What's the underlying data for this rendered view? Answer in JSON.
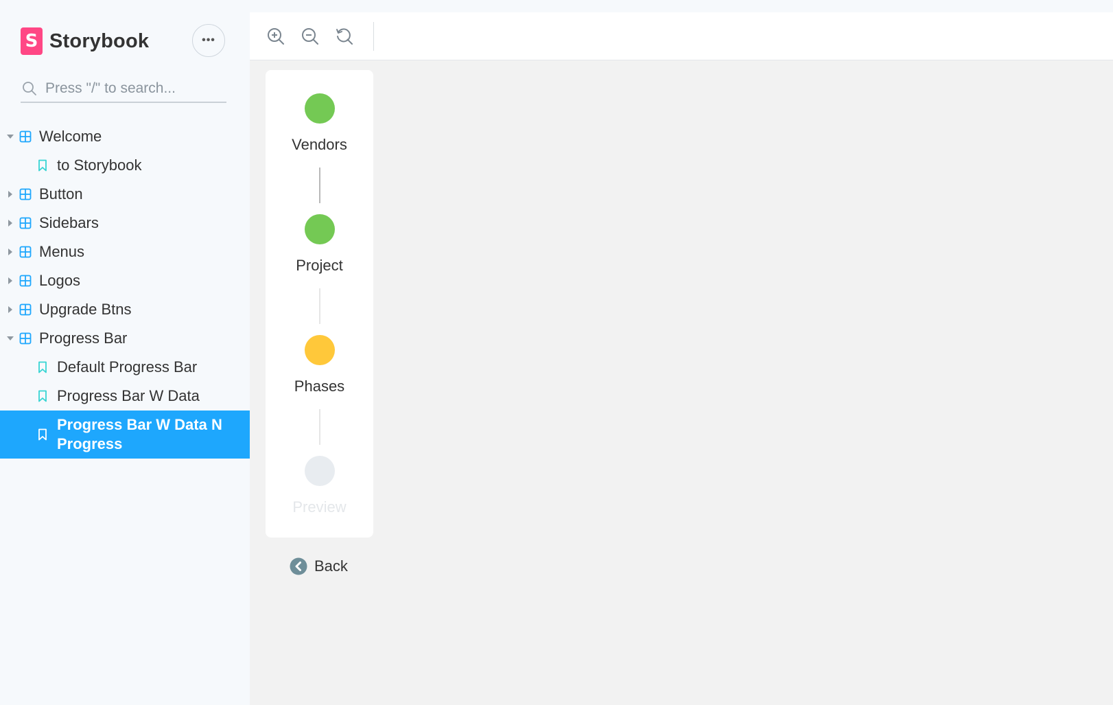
{
  "brand": {
    "logo_letter": "S",
    "name": "Storybook"
  },
  "menu": {
    "label": "•••"
  },
  "search": {
    "placeholder": "Press \"/\" to search..."
  },
  "tree": {
    "welcome": {
      "label": "Welcome",
      "expanded": true
    },
    "to_storybook": {
      "label": "to Storybook"
    },
    "button": {
      "label": "Button",
      "expanded": false
    },
    "sidebars": {
      "label": "Sidebars",
      "expanded": false
    },
    "menus": {
      "label": "Menus",
      "expanded": false
    },
    "logos": {
      "label": "Logos",
      "expanded": false
    },
    "upgrade_btns": {
      "label": "Upgrade Btns",
      "expanded": false
    },
    "progress_bar": {
      "label": "Progress Bar",
      "expanded": true
    },
    "default_progress_bar": {
      "label": "Default Progress Bar"
    },
    "progress_bar_w_data": {
      "label": "Progress Bar W Data"
    },
    "progress_bar_w_data_n_progress": {
      "label": "Progress Bar W Data N Progress",
      "selected": true
    }
  },
  "toolbar": {
    "zoom_in_icon": "zoom-in-icon",
    "zoom_out_icon": "zoom-out-icon",
    "reset_icon": "zoom-reset-icon"
  },
  "progress": {
    "steps": [
      {
        "label": "Vendors",
        "status": "complete",
        "color": "#74c954"
      },
      {
        "label": "Project",
        "status": "complete",
        "color": "#74c954"
      },
      {
        "label": "Phases",
        "status": "in-progress",
        "color": "#ffc83a"
      },
      {
        "label": "Preview",
        "status": "pending",
        "color": "#e8ecf0"
      }
    ],
    "back_label": "Back"
  },
  "colors": {
    "accent": "#1ea7fd",
    "brand": "#ff4785",
    "folder_icon": "#1ea7fd",
    "leaf_icon": "#37d5d3",
    "complete": "#74c954",
    "in_progress": "#ffc83a",
    "pending": "#e8ecf0"
  }
}
